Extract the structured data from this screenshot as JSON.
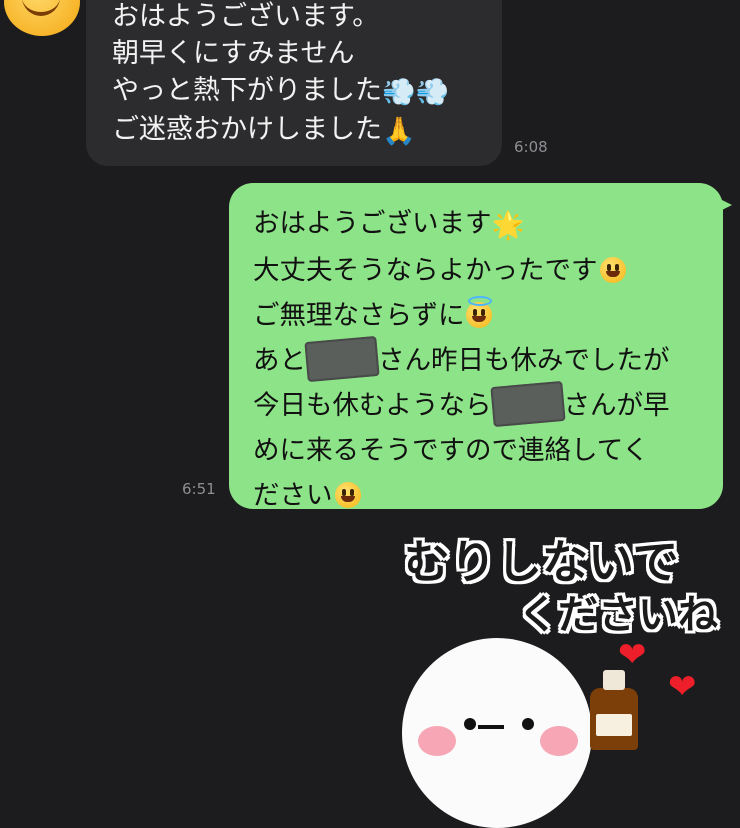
{
  "incoming": {
    "lines": [
      "おはようございます。",
      "朝早くにすみません",
      "やっと熱下がりました",
      "ご迷惑おかけしました"
    ],
    "emojis": {
      "line3": "💨💨",
      "line4": "🙏"
    },
    "time": "6:08"
  },
  "outgoing": {
    "line1": "おはようございます",
    "line2": "大丈夫そうならよかったです",
    "line3": "ご無理なさらずに",
    "line4a": "あと",
    "line4b": "さん昨日も休みでしたが",
    "line5a": "今日も休むようなら",
    "line5b": "さんが早",
    "line6": "めに来るそうですので連絡してく",
    "line7": "ださい",
    "emojis": {
      "star": "🌟"
    },
    "time": "6:51"
  },
  "sticker": {
    "line1": "むりしないで",
    "line2": "くださいね",
    "heart": "❤"
  },
  "colors": {
    "background": "#1c1c1e",
    "incoming_bubble": "#2c2c2e",
    "outgoing_bubble": "#8de388"
  }
}
